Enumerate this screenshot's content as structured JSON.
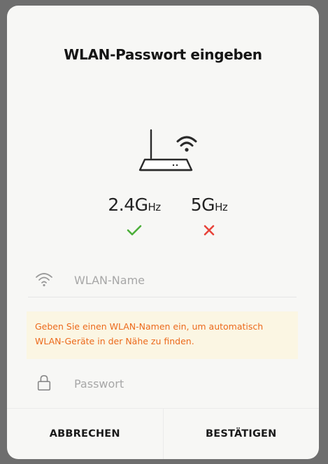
{
  "dialog": {
    "title": "WLAN-Passwort eingeben",
    "bands": [
      {
        "label": "2.4G",
        "unit": "Hz",
        "status": "supported",
        "status_color": "#4caf3a"
      },
      {
        "label": "5G",
        "unit": "Hz",
        "status": "unsupported",
        "status_color": "#e8433a"
      }
    ],
    "wifi_field": {
      "placeholder": "WLAN-Name",
      "icon": "wifi-icon"
    },
    "hint": "Geben Sie einen WLAN-Namen ein, um automatisch WLAN-Geräte in der Nähe zu finden.",
    "password_field": {
      "placeholder": "Passwort",
      "icon": "lock-icon"
    },
    "buttons": {
      "cancel": "ABBRECHEN",
      "confirm": "BESTÄTIGEN"
    }
  },
  "colors": {
    "accent": "#ec6a1c",
    "hint_bg": "#fbf6e3",
    "check": "#4caf3a",
    "cross": "#e8433a"
  }
}
